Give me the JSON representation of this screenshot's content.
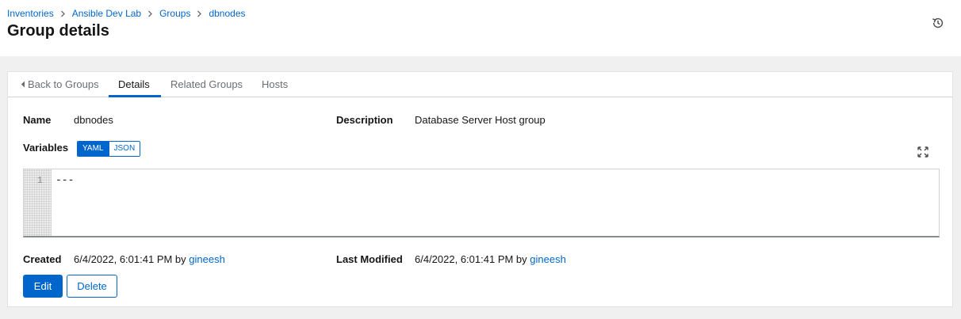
{
  "breadcrumb": {
    "items": [
      "Inventories",
      "Ansible Dev Lab",
      "Groups"
    ],
    "current": "dbnodes"
  },
  "page_title": "Group details",
  "tabs": {
    "back": "Back to Groups",
    "details": "Details",
    "related_groups": "Related Groups",
    "hosts": "Hosts",
    "active": "Details"
  },
  "details": {
    "name_label": "Name",
    "name_value": "dbnodes",
    "description_label": "Description",
    "description_value": "Database Server Host group",
    "variables_label": "Variables"
  },
  "variables_toggle": {
    "yaml": "YAML",
    "json": "JSON",
    "selected": "YAML"
  },
  "editor": {
    "line_number": "1",
    "content": "---"
  },
  "created": {
    "label": "Created",
    "value": "6/4/2022, 6:01:41 PM by",
    "user": "gineesh"
  },
  "modified": {
    "label": "Last Modified",
    "value": "6/4/2022, 6:01:41 PM by",
    "user": "gineesh"
  },
  "actions": {
    "edit": "Edit",
    "delete": "Delete"
  },
  "icons": {
    "history": "history-icon",
    "expand": "expand-icon",
    "back_caret": "caret-left-icon",
    "breadcrumb_separator": "chevron-right-icon"
  },
  "colors": {
    "accent": "#0066cc",
    "page_bg": "#f0f0f0",
    "text": "#151515",
    "muted_text": "#6a6e73"
  }
}
